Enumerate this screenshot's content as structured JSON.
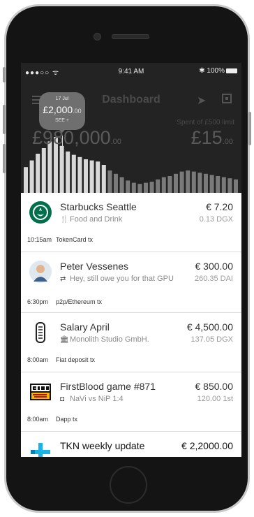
{
  "status": {
    "carrier": "●●●○○ ᯤ",
    "time": "9:41 AM",
    "battery": "✱ 100%"
  },
  "header": {
    "title": "Dashboard",
    "spent": "Spent of £500 limit",
    "left_balance_main": "£980,000",
    "left_balance_dec": ".00",
    "right_balance_main": "£15",
    "right_balance_dec": ".00"
  },
  "tooltip": {
    "date": "17 Jul",
    "amount_main": "£2,000",
    "amount_dec": ".00",
    "sub": "SEE +"
  },
  "histogram": [
    46,
    58,
    70,
    80,
    92,
    100,
    84,
    74,
    68,
    64,
    60,
    58,
    56,
    50,
    40,
    34,
    28,
    22,
    18,
    16,
    18,
    20,
    24,
    28,
    30,
    34,
    38,
    40,
    38,
    36,
    34,
    32,
    30,
    28,
    26,
    24
  ],
  "transactions": [
    {
      "name": "Starbucks Seattle",
      "sub_icon": "fork-knife-icon",
      "sub_glyph": "🍴",
      "sub": "Food and Drink",
      "amount": "€ 7.20",
      "token": "0.13 DGX",
      "time": "10:15am",
      "type": "TokenCard tx"
    },
    {
      "name": "Peter Vessenes",
      "sub_icon": "transfer-icon",
      "sub_glyph": "⇄",
      "sub": "Hey, still owe you for that GPU",
      "amount": "€ 300.00",
      "token": "260.35 DAI",
      "time": "6:30pm",
      "type": "p2p/Ethereum tx"
    },
    {
      "name": "Salary April",
      "sub_icon": "bank-icon",
      "sub_glyph": "🏛",
      "sub": "Monolith Studio GmbH.",
      "amount": "€ 4,500.00",
      "token": "137.05 DGX",
      "time": "8:00am",
      "type": "Fiat deposit tx"
    },
    {
      "name": "FirstBlood game #871",
      "sub_icon": "game-icon",
      "sub_glyph": "◘",
      "sub": "NaVi vs NiP 1:4",
      "amount": "€ 850.00",
      "token": "120.00 1st",
      "time": "8:00am",
      "type": "Dapp tx"
    },
    {
      "name": "TKN weekly update",
      "sub_icon": "",
      "sub_glyph": "",
      "sub": "",
      "amount": "€ 2,2000.00",
      "token": "",
      "time": "",
      "type": ""
    }
  ],
  "colors": {
    "header_bg": "#232323",
    "bar_active": "#d8d8d8",
    "bar_idle": "#7a7a7a",
    "starbucks": "#00704A",
    "tkn": "#1bb3e6"
  }
}
